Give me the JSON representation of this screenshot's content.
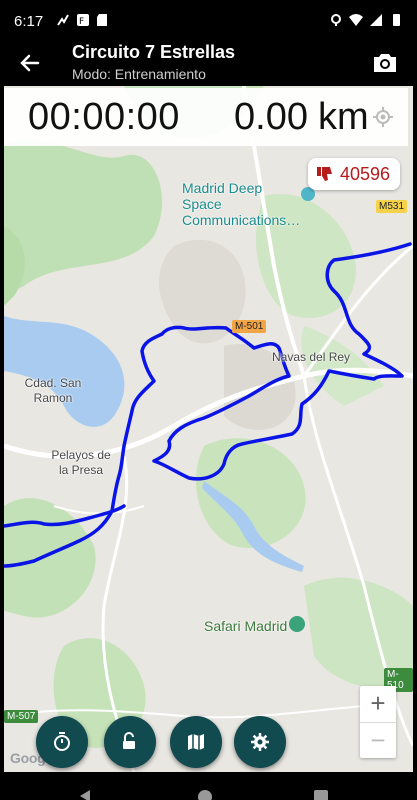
{
  "status_bar": {
    "time": "6:17"
  },
  "app_bar": {
    "title": "Circuito 7 Estrellas",
    "subtitle": "Modo: Entrenamiento"
  },
  "stats": {
    "elapsed_time": "00:00:00",
    "distance_value": "0.00",
    "distance_unit": "km"
  },
  "rating": {
    "value": "40596"
  },
  "map": {
    "labels": {
      "poi_space": "Madrid Deep Space Communications…",
      "town_navas": "Navas del Rey",
      "town_cdad": "Cdad. San Ramon",
      "town_pelayos": "Pelayos de la Presa",
      "poi_safari": "Safari Madrid"
    },
    "roads": {
      "m501": "M-501",
      "m531": "M531",
      "m507": "M-507",
      "m510": "M-510"
    },
    "zoom_in": "+",
    "zoom_out": "−",
    "attribution": "Google",
    "route_color": "#0a14e6"
  },
  "icons": {
    "back": "arrow-left-icon",
    "camera": "camera-icon",
    "location": "my-location-icon",
    "rating": "thumbs-down-icon",
    "fab_1": "stopwatch-icon",
    "fab_2": "unlock-icon",
    "fab_3": "map-icon",
    "fab_4": "settings-icon"
  },
  "colors": {
    "fab_background": "#114a4f",
    "rating_text": "#b71c1c"
  }
}
